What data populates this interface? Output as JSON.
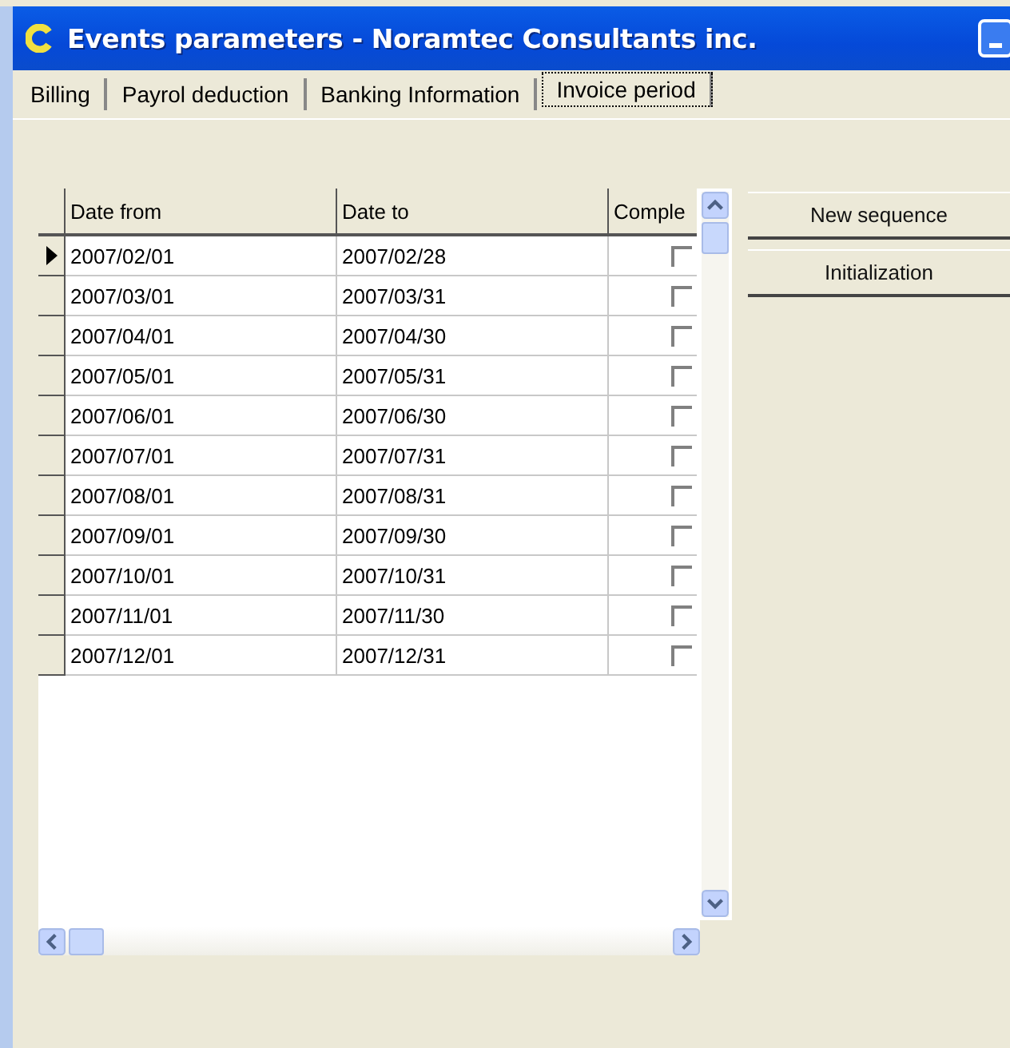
{
  "window": {
    "title": "Events parameters - Noramtec Consultants inc."
  },
  "tabs": [
    {
      "label": "Billing",
      "selected": false
    },
    {
      "label": "Payrol deduction",
      "selected": false
    },
    {
      "label": "Banking Information",
      "selected": false
    },
    {
      "label": "Invoice period",
      "selected": true
    }
  ],
  "grid": {
    "columns": [
      "Date from",
      "Date to",
      "Comple"
    ],
    "rows": [
      {
        "date_from": "2007/02/01",
        "date_to": "2007/02/28",
        "completed": false,
        "selected": true
      },
      {
        "date_from": "2007/03/01",
        "date_to": "2007/03/31",
        "completed": false,
        "selected": false
      },
      {
        "date_from": "2007/04/01",
        "date_to": "2007/04/30",
        "completed": false,
        "selected": false
      },
      {
        "date_from": "2007/05/01",
        "date_to": "2007/05/31",
        "completed": false,
        "selected": false
      },
      {
        "date_from": "2007/06/01",
        "date_to": "2007/06/30",
        "completed": false,
        "selected": false
      },
      {
        "date_from": "2007/07/01",
        "date_to": "2007/07/31",
        "completed": false,
        "selected": false
      },
      {
        "date_from": "2007/08/01",
        "date_to": "2007/08/31",
        "completed": false,
        "selected": false
      },
      {
        "date_from": "2007/09/01",
        "date_to": "2007/09/30",
        "completed": false,
        "selected": false
      },
      {
        "date_from": "2007/10/01",
        "date_to": "2007/10/31",
        "completed": false,
        "selected": false
      },
      {
        "date_from": "2007/11/01",
        "date_to": "2007/11/30",
        "completed": false,
        "selected": false
      },
      {
        "date_from": "2007/12/01",
        "date_to": "2007/12/31",
        "completed": false,
        "selected": false
      }
    ]
  },
  "buttons": [
    "New sequence",
    "Initialization"
  ]
}
